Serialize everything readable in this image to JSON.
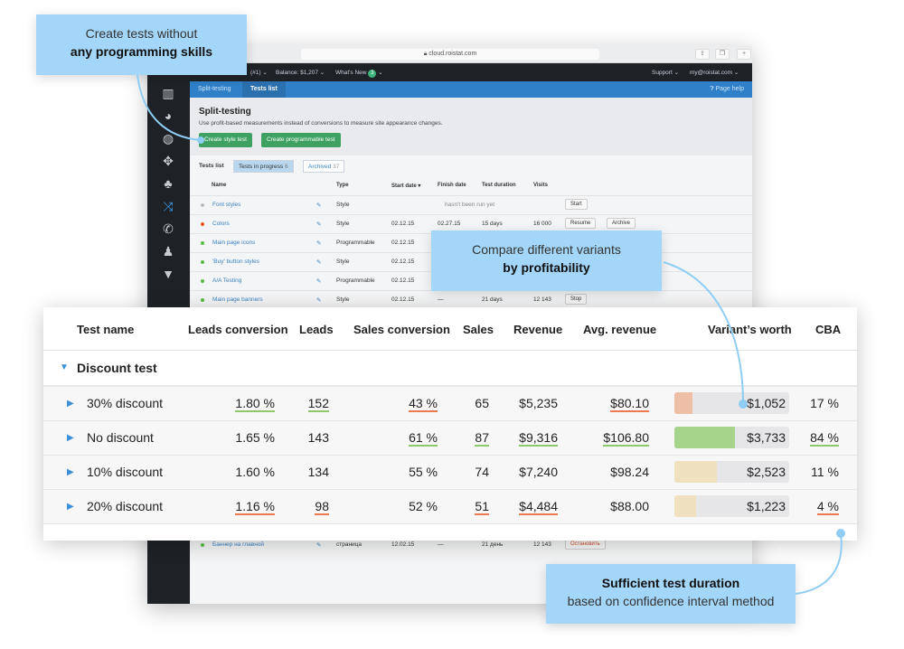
{
  "browser": {
    "url": "cloud.roistat.com"
  },
  "topnav": {
    "project": "(#1)",
    "balance": "Balance: $1,207",
    "whats_new": "What's New",
    "whats_new_count": "3",
    "support": "Support",
    "account": "my@roistat.com"
  },
  "tabs": [
    {
      "label": "Split-testing"
    },
    {
      "label": "Tests list"
    }
  ],
  "page_help": "Page help",
  "header": {
    "title": "Split-testing",
    "description": "Use profit-based measurements instead of conversions to measure site appearance changes.",
    "create_style": "Create style test",
    "create_prog": "Create programmable test"
  },
  "list": {
    "label": "Tests list",
    "in_progress": "Tests in progress",
    "in_progress_count": "6",
    "archived": "Archived",
    "archived_count": "37",
    "columns": [
      "Name",
      "Type",
      "Start date ▾",
      "Finish date",
      "Test duration",
      "Visits"
    ],
    "rows": [
      {
        "name": "Font styles",
        "status": "#bbbbbb",
        "type": "Style",
        "start": "",
        "finish": "",
        "duration": "hasn't been run yet",
        "visits": "",
        "actions": [
          "Start"
        ]
      },
      {
        "name": "Colors",
        "status": "#e0562b",
        "type": "Style",
        "start": "02.12.15",
        "finish": "02.27.15",
        "duration": "15 days",
        "visits": "16 000",
        "actions": [
          "Resume",
          "Archive"
        ]
      },
      {
        "name": "Main page icons",
        "status": "#5cb84a",
        "type": "Programmable",
        "start": "02.12.15",
        "finish": "",
        "duration": "",
        "visits": "",
        "actions": []
      },
      {
        "name": "'Buy' button styles",
        "status": "#5cb84a",
        "type": "Style",
        "start": "02.12.15",
        "finish": "",
        "duration": "",
        "visits": "",
        "actions": []
      },
      {
        "name": "A/A Testing",
        "status": "#5cb84a",
        "type": "Programmable",
        "start": "02.12.15",
        "finish": "",
        "duration": "",
        "visits": "",
        "actions": []
      },
      {
        "name": "Main page banners",
        "status": "#5cb84a",
        "type": "Style",
        "start": "02.12.15",
        "finish": "—",
        "duration": "21 days",
        "visits": "12 143",
        "actions": [
          "Stop"
        ]
      },
      {
        "name": "Баннер на главной",
        "status": "#5cb84a",
        "type": "страница",
        "start": "12.02.15",
        "finish": "—",
        "duration": "21 день",
        "visits": "12 143",
        "actions": [
          "Остановить"
        ]
      }
    ]
  },
  "overlay": {
    "columns": [
      "Test name",
      "Leads conversion",
      "Leads",
      "Sales conversion",
      "Sales",
      "Revenue",
      "Avg. revenue",
      "Variant’s worth",
      "CBA"
    ],
    "group": "Discount test",
    "rows": [
      {
        "name": "30% discount",
        "lc": "1.80 %",
        "leads": "152",
        "sc": "43 %",
        "sales": "65",
        "rev": "$5,235",
        "avg": "$80.10",
        "worth": "$1,052",
        "worth_fill": 0.16,
        "worth_color": "#eebfa6",
        "cba": "17 %",
        "marks": {
          "lc": "g",
          "leads": "g",
          "sc": "r",
          "avg": "r"
        }
      },
      {
        "name": "No discount",
        "lc": "1.65 %",
        "leads": "143",
        "sc": "61 %",
        "sales": "87",
        "rev": "$9,316",
        "avg": "$106.80",
        "worth": "$3,733",
        "worth_fill": 0.53,
        "worth_color": "#a6d48a",
        "cba": "84 %",
        "marks": {
          "sc": "g",
          "sales": "g",
          "rev": "g",
          "avg": "g",
          "cba": "g"
        }
      },
      {
        "name": "10% discount",
        "lc": "1.60 %",
        "leads": "134",
        "sc": "55 %",
        "sales": "74",
        "rev": "$7,240",
        "avg": "$98.24",
        "worth": "$2,523",
        "worth_fill": 0.37,
        "worth_color": "#efe0c0",
        "cba": "11 %",
        "marks": {}
      },
      {
        "name": "20% discount",
        "lc": "1.16 %",
        "leads": "98",
        "sc": "52 %",
        "sales": "51",
        "rev": "$4,484",
        "avg": "$88.00",
        "worth": "$1,223",
        "worth_fill": 0.19,
        "worth_color": "#efe0c0",
        "cba": "4 %",
        "marks": {
          "lc": "r",
          "leads": "r",
          "sales": "r",
          "rev": "r",
          "cba": "r"
        }
      }
    ]
  },
  "callouts": [
    {
      "line1": "Create tests without",
      "line2": "any programming skills"
    },
    {
      "line1": "Compare different variants",
      "line2": "by profitability"
    },
    {
      "line1": "Sufficient test duration",
      "line2": "based on confidence interval method"
    }
  ],
  "colors": {
    "accent": "#2f80c9",
    "green_btn": "#3ea162",
    "callout": "#a3d6f8",
    "good": "#8dc96b",
    "bad": "#ec7a4c"
  }
}
